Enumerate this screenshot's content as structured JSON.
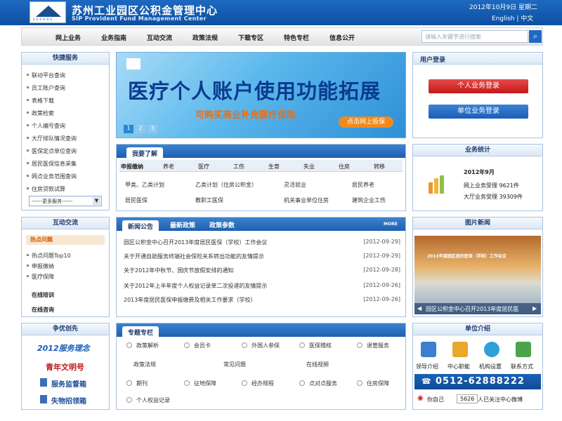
{
  "header": {
    "title_cn": "苏州工业园区公积金管理中心",
    "title_en": "SIP Provident Fund Management Center",
    "logo_text": "SUZHOU",
    "date": "2012年10月9日 星期二",
    "lang": "English | 中文"
  },
  "nav": {
    "items": [
      "网上业务",
      "业务指南",
      "互动交流",
      "政策法规",
      "下载专区",
      "特色专栏",
      "信息公开"
    ],
    "search_placeholder": "请输入关键字进行搜索",
    "search_icon": "search-icon"
  },
  "quick": {
    "title": "快捷服务",
    "links": [
      "联动平台查询",
      "员工账户查询",
      "表格下载",
      "政策检索",
      "个人编号查询",
      "大厅排队情况查询",
      "医保定点单位查询",
      "居民医保信息采集",
      "网点业务范围查询",
      "住房贷款试算"
    ],
    "more": "------更多服务------"
  },
  "interact": {
    "title": "互动交流",
    "hot": "热点问题",
    "hot_top": "热点问题Top10",
    "items": [
      "申报缴纳",
      "医疗保障"
    ],
    "training": "在线培训",
    "consult": "在线咨询"
  },
  "award": {
    "title": "争优创先",
    "items": [
      "2012服务理念",
      "青年文明号",
      "服务监督箱",
      "失物招领箱"
    ]
  },
  "banner": {
    "title": "医疗个人账户使用功能拓展",
    "sub": "可购买商业补充医疗保险",
    "btn": "点击网上投保",
    "pages": [
      "1",
      "2",
      "3"
    ]
  },
  "know": {
    "title": "我要了解",
    "tabs": [
      "申报缴纳",
      "养老",
      "医疗",
      "工伤",
      "生育",
      "失业",
      "住房",
      "转移"
    ],
    "items": [
      "甲类、乙类计划",
      "乙类计划（住房公积金）",
      "灵活就业",
      "居民养老",
      "居民医保",
      "教职工医保",
      "机关事业单位住房",
      "建筑企业工伤"
    ]
  },
  "news": {
    "tabs": [
      "新闻公告",
      "最新政策",
      "政策参数"
    ],
    "more": "MORE",
    "rows": [
      {
        "t": "园区公积金中心召开2013年度居民医保（学校）工作会议",
        "d": "[2012-09-29]"
      },
      {
        "t": "关于开通自助服务终端社会保险关系转出功能的友情提示",
        "d": "[2012-09-29]"
      },
      {
        "t": "关于2012年中秋节、国庆节放假安排的通知",
        "d": "[2012-09-28]"
      },
      {
        "t": "关于2012年上半年度个人权益记录单二次投递的友情提示",
        "d": "[2012-09-26]"
      },
      {
        "t": "2013年度居民医保申报缴费及相关工作要求（学校）",
        "d": "[2012-09-26]"
      }
    ]
  },
  "special": {
    "title": "专题专栏",
    "row1": [
      "政策解析",
      "会员卡",
      "外国人参保",
      "医保稽核",
      "退管服务"
    ],
    "row2": [
      "政策法规",
      "常见问题",
      "在线视频"
    ],
    "row3": [
      "期刊",
      "征地保障",
      "经办规程",
      "点对点服务",
      "住房保障"
    ],
    "row4": [
      "个人权益记录"
    ]
  },
  "login": {
    "title": "用户登录",
    "personal": "个人业务登录",
    "unit": "单位业务登录"
  },
  "stats": {
    "title": "业务统计",
    "month": "2012年9月",
    "online": "网上业务受理 9621件",
    "hall": "大厅业务受理 39309件"
  },
  "photo": {
    "title": "图片新闻",
    "caption": "园区公积金中心召开2013年度居民医",
    "banner_text": "2013年度园区居民医保（学校）工作会议"
  },
  "unit": {
    "title": "单位介绍",
    "items": [
      "领导介绍",
      "中心职能",
      "机构设置",
      "联系方式"
    ],
    "phone": "0512-62888222",
    "weibo_count": "5626",
    "weibo_text": "人已关注中心微博",
    "weibo_label": "你自己"
  }
}
